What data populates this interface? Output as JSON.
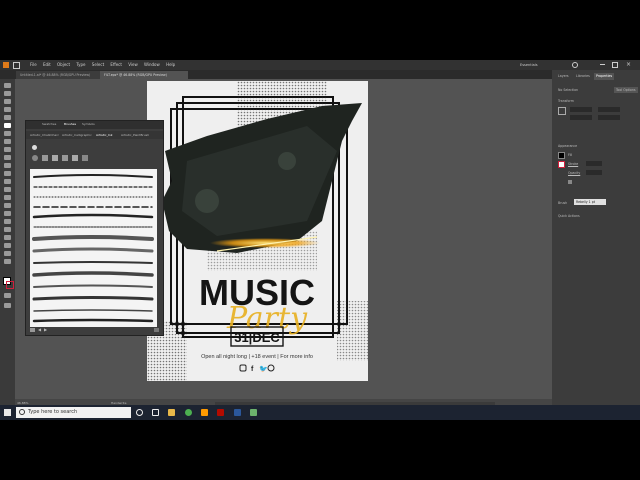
{
  "menubar": {
    "items": [
      "File",
      "Edit",
      "Object",
      "Type",
      "Select",
      "Effect",
      "View",
      "Window",
      "Help"
    ],
    "workspace": "Essentials"
  },
  "tabs": [
    {
      "label": "Untitled-1.ai* @ 46.88% (RGB/GPU Preview)"
    },
    {
      "label": "FILT.eps* @ 46.88% (RGB/GPU Preview)"
    }
  ],
  "right_panel": {
    "tabs": [
      "Layers",
      "Libraries",
      "Properties"
    ],
    "no_selection": "No Selection",
    "tool_options": "Tool Options",
    "transform": "Transform",
    "appearance": "Appearance",
    "fill": "Fill",
    "stroke": "Stroke",
    "opacity": "Opacity",
    "brush": "Brush",
    "brush_value": "Rebelly 1 pt",
    "quick_actions": "Quick Actions"
  },
  "brushes_panel": {
    "top_tabs": [
      "Swatches",
      "Brushes",
      "Symbols"
    ],
    "lib_tabs": [
      "Artistic_ChalkCharc",
      "Artistic_Calligraphic",
      "Artistic_Ink",
      "Artistic_PaintBrush"
    ]
  },
  "poster": {
    "title": "MUSIC",
    "script": "Party",
    "date": "31|DEC",
    "tagline": "Open all night long | +18 event | For more info"
  },
  "status": {
    "zoom": "46.88%",
    "tool": "Handwrite"
  },
  "taskbar": {
    "search_placeholder": "Type here to search"
  }
}
